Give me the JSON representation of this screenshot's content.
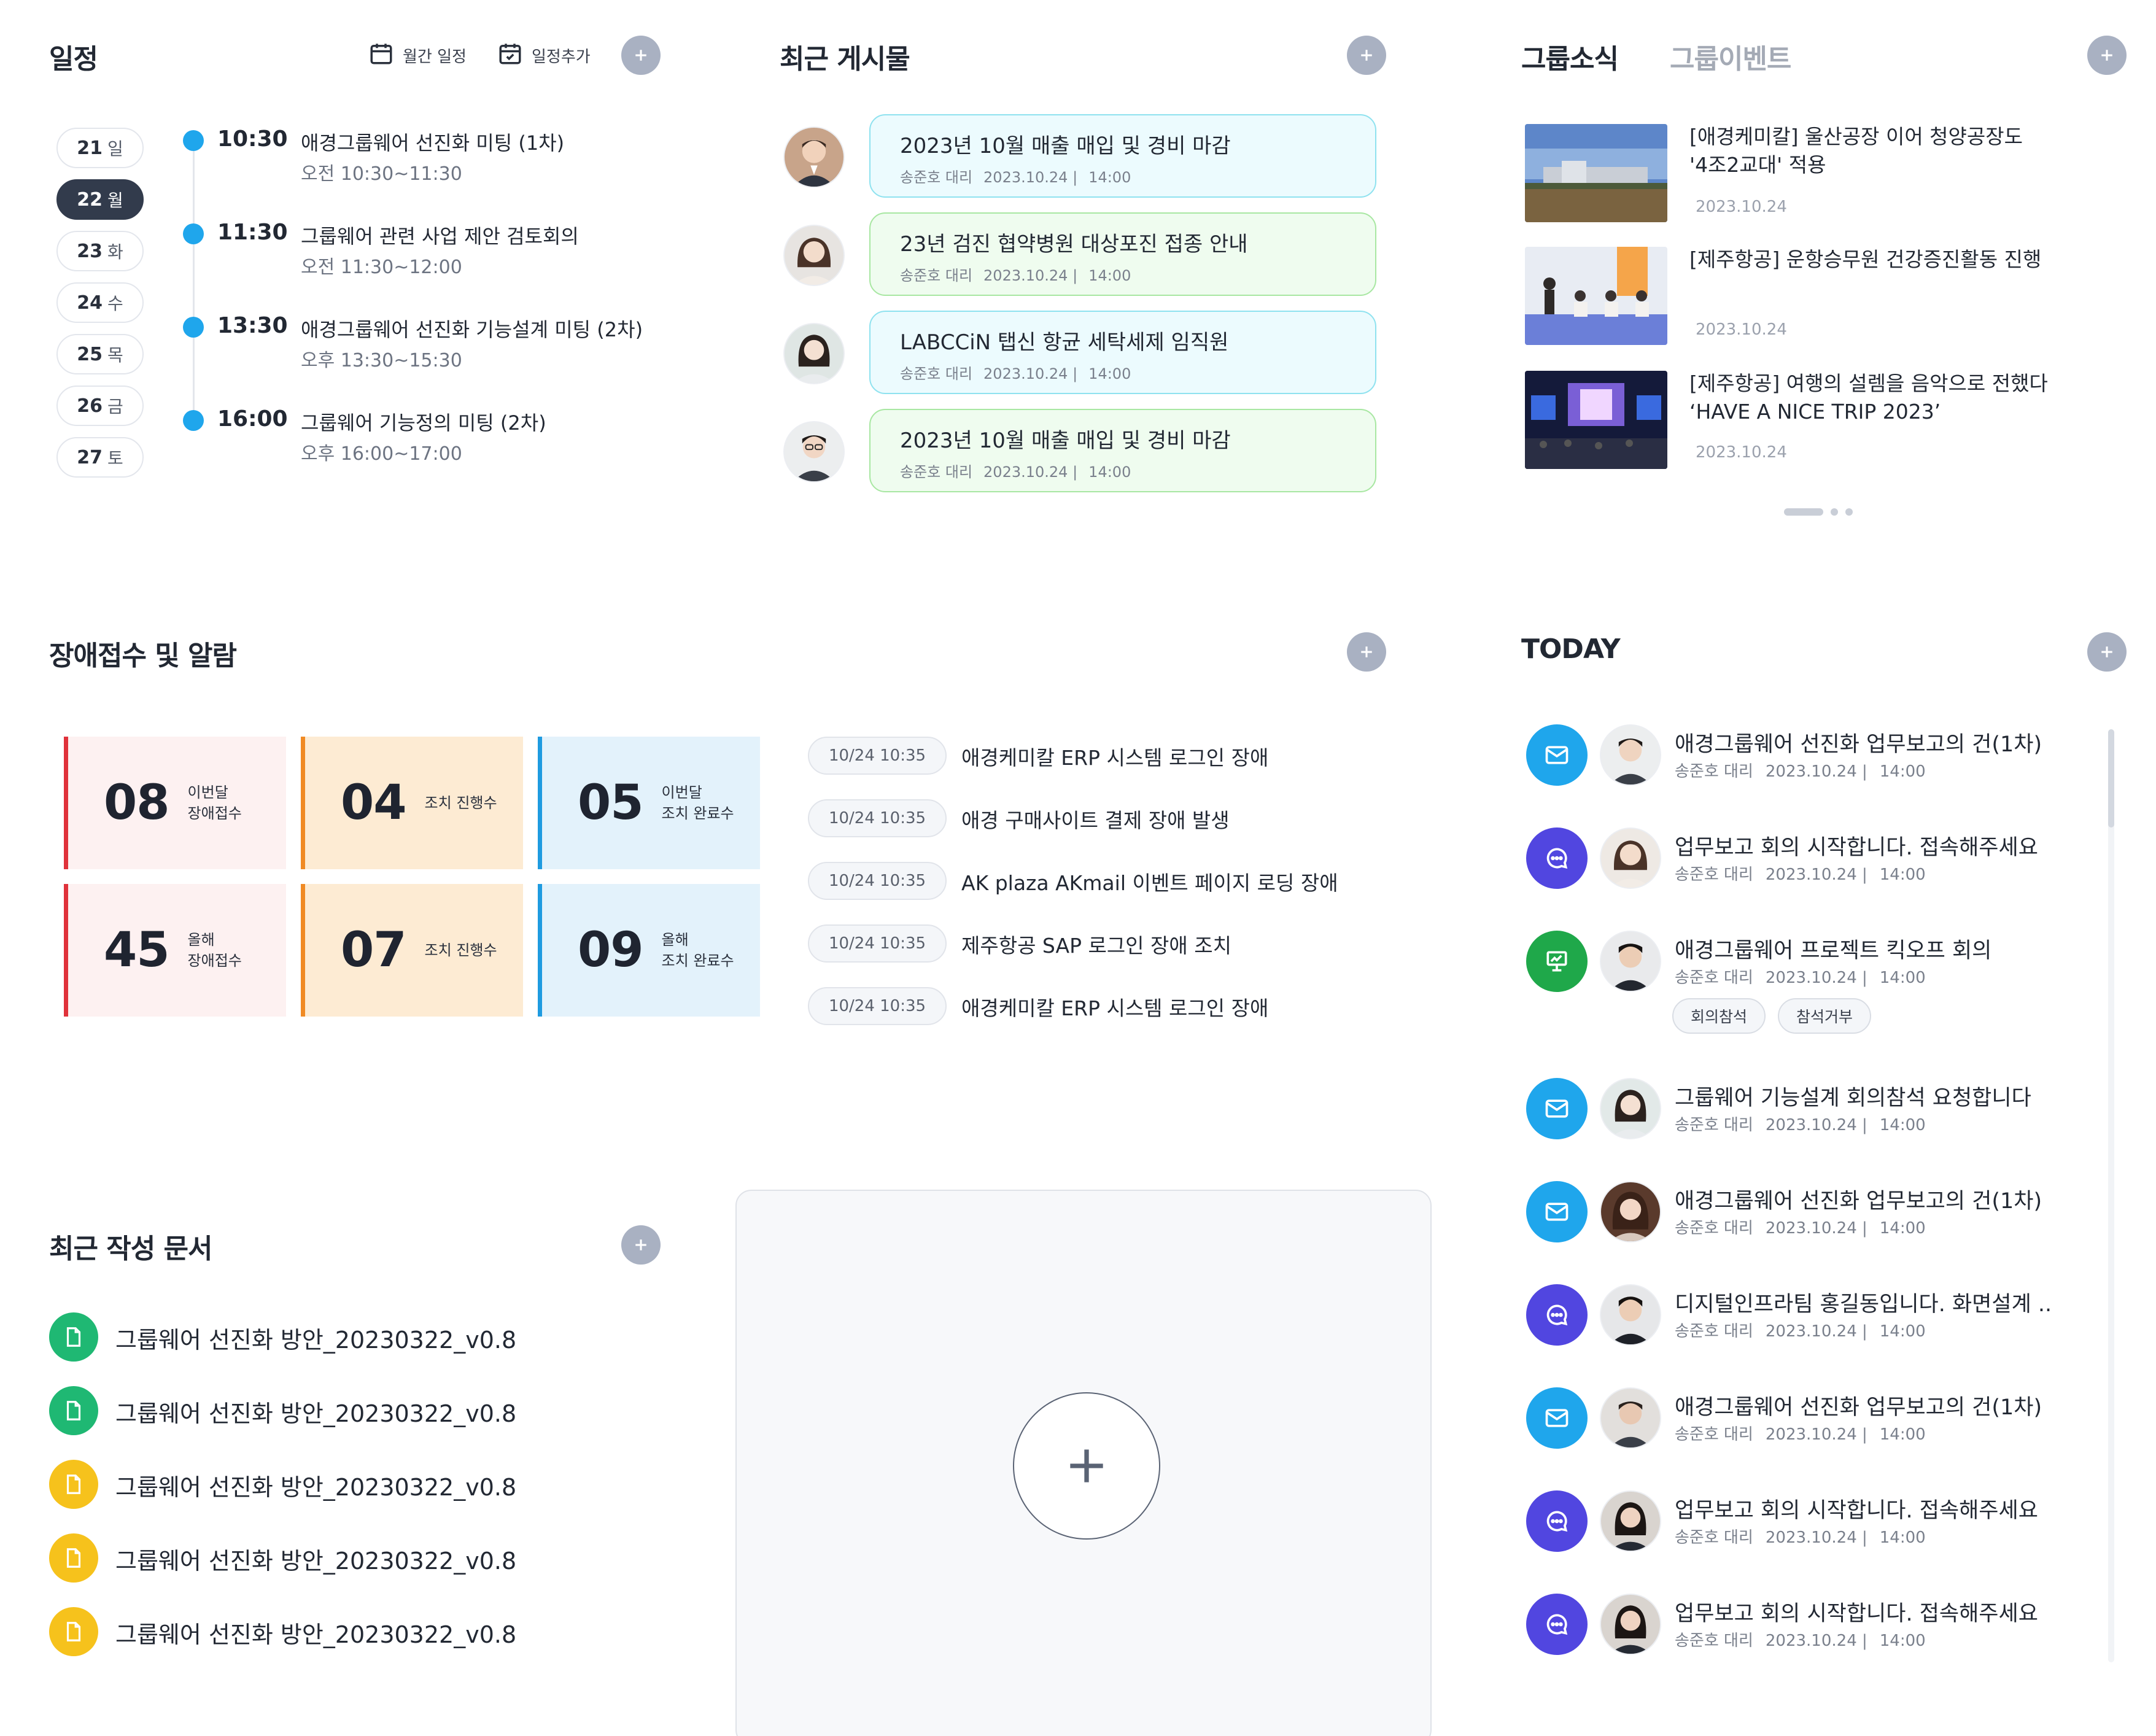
{
  "schedule": {
    "title": "일정",
    "monthly_label": "월간 일정",
    "add_label": "일정추가",
    "days": [
      {
        "num": "21",
        "wd": "일"
      },
      {
        "num": "22",
        "wd": "월"
      },
      {
        "num": "23",
        "wd": "화"
      },
      {
        "num": "24",
        "wd": "수"
      },
      {
        "num": "25",
        "wd": "목"
      },
      {
        "num": "26",
        "wd": "금"
      },
      {
        "num": "27",
        "wd": "토"
      }
    ],
    "events": [
      {
        "time": "10:30",
        "title": "애경그룹웨어 선진화 미팅 (1차)",
        "range": "오전 10:30~11:30"
      },
      {
        "time": "11:30",
        "title": "그룹웨어 관련 사업 제안 검토회의",
        "range": "오전 11:30~12:00"
      },
      {
        "time": "13:30",
        "title": "애경그룹웨어 선진화 기능설계 미팅 (2차)",
        "range": "오후 13:30~15:30"
      },
      {
        "time": "16:00",
        "title": "그룹웨어 기능정의 미팅 (2차)",
        "range": "오후 16:00~17:00"
      }
    ]
  },
  "posts": {
    "title": "최근 게시물",
    "items": [
      {
        "title": "2023년 10월 매출 매입 및 경비 마감",
        "author": "송준호 대리",
        "date": "2023.10.24 |",
        "time": "14:00"
      },
      {
        "title": "23년 검진 협약병원 대상포진 접종 안내",
        "author": "송준호 대리",
        "date": "2023.10.24 |",
        "time": "14:00"
      },
      {
        "title": "LABCCiN 탭신 항균 세탁세제 임직원",
        "author": "송준호 대리",
        "date": "2023.10.24 |",
        "time": "14:00"
      },
      {
        "title": "2023년 10월 매출 매입 및 경비 마감",
        "author": "송준호 대리",
        "date": "2023.10.24 |",
        "time": "14:00"
      }
    ]
  },
  "news": {
    "tab_active": "그룹소식",
    "tab_inactive": "그룹이벤트",
    "items": [
      {
        "line1": "[애경케미칼] 울산공장 이어 청양공장도",
        "line2": "'4조2교대' 적용",
        "date": "2023.10.24"
      },
      {
        "line1": "[제주항공] 운항승무원 건강증진활동 진행",
        "line2": "",
        "date": "2023.10.24"
      },
      {
        "line1": "[제주항공] 여행의 설렘을 음악으로 전했다",
        "line2": "‘HAVE A NICE TRIP 2023’",
        "date": "2023.10.24"
      }
    ]
  },
  "alarm": {
    "title": "장애접수 및 알람",
    "stats": [
      {
        "num": "08",
        "l1": "이번달",
        "l2": "장애접수",
        "color": "#e0323b",
        "bg": "#fdf1f1"
      },
      {
        "num": "04",
        "l1": "조치 진행수",
        "l2": "",
        "color": "#f08a24",
        "bg": "#fdebd3"
      },
      {
        "num": "05",
        "l1": "이번달",
        "l2": "조치 완료수",
        "color": "#1f9be0",
        "bg": "#e3f2fb"
      },
      {
        "num": "45",
        "l1": "올해",
        "l2": "장애접수",
        "color": "#e0323b",
        "bg": "#fdf1f1"
      },
      {
        "num": "07",
        "l1": "조치 진행수",
        "l2": "",
        "color": "#f08a24",
        "bg": "#fdebd3"
      },
      {
        "num": "09",
        "l1": "올해",
        "l2": "조치 완료수",
        "color": "#1f9be0",
        "bg": "#e3f2fb"
      }
    ],
    "items": [
      {
        "time": "10/24  10:35",
        "text": "애경케미칼 ERP 시스템 로그인 장애"
      },
      {
        "time": "10/24  10:35",
        "text": "애경 구매사이트 결제 장애 발생"
      },
      {
        "time": "10/24  10:35",
        "text": "AK plaza AKmail 이벤트 페이지 로딩 장애"
      },
      {
        "time": "10/24  10:35",
        "text": "제주항공 SAP 로그인 장애 조치"
      },
      {
        "time": "10/24  10:35",
        "text": "애경케미칼 ERP 시스템 로그인 장애"
      }
    ]
  },
  "docs": {
    "title": "최근 작성 문서",
    "items": [
      {
        "name": "그룹웨어 선진화 방안_20230322_v0.8",
        "color": "#1fb873"
      },
      {
        "name": "그룹웨어 선진화 방안_20230322_v0.8",
        "color": "#1fb873"
      },
      {
        "name": "그룹웨어 선진화 방안_20230322_v0.8",
        "color": "#f6c21c"
      },
      {
        "name": "그룹웨어 선진화 방안_20230322_v0.8",
        "color": "#f6c21c"
      },
      {
        "name": "그룹웨어 선진화 방안_20230322_v0.8",
        "color": "#f6c21c"
      }
    ]
  },
  "today": {
    "title": "TODAY",
    "items": [
      {
        "icon": "mail-icon",
        "title": "애경그룹웨어 선진화 업무보고의 건(1차)",
        "author": "송준호 대리",
        "date": "2023.10.24 |",
        "time": "14:00"
      },
      {
        "icon": "chat-icon",
        "title": "업무보고 회의 시작합니다. 접속해주세요",
        "author": "송준호 대리",
        "date": "2023.10.24 |",
        "time": "14:00"
      },
      {
        "icon": "presentation-icon",
        "title": "애경그룹웨어 프로젝트 킥오프 회의",
        "author": "송준호 대리",
        "date": "2023.10.24 |",
        "time": "14:00"
      },
      {
        "icon": "mail-icon",
        "title": "그룹웨어 기능설계 회의참석 요청합니다",
        "author": "송준호 대리",
        "date": "2023.10.24 |",
        "time": "14:00"
      },
      {
        "icon": "mail-icon",
        "title": "애경그룹웨어 선진화 업무보고의 건(1차)",
        "author": "송준호 대리",
        "date": "2023.10.24 |",
        "time": "14:00"
      },
      {
        "icon": "chat-icon",
        "title": "디지털인프라팀 홍길동입니다. 화면설계 ..",
        "author": "송준호 대리",
        "date": "2023.10.24 |",
        "time": "14:00"
      },
      {
        "icon": "mail-icon",
        "title": "애경그룹웨어 선진화 업무보고의 건(1차)",
        "author": "송준호 대리",
        "date": "2023.10.24 |",
        "time": "14:00"
      },
      {
        "icon": "chat-icon",
        "title": "업무보고 회의 시작합니다. 접속해주세요",
        "author": "송준호 대리",
        "date": "2023.10.24 |",
        "time": "14:00"
      },
      {
        "icon": "chat-icon",
        "title": "업무보고 회의 시작합니다. 접속해주세요",
        "author": "송준호 대리",
        "date": "2023.10.24 |",
        "time": "14:00"
      }
    ],
    "attend_label": "회의참석",
    "decline_label": "참석거부"
  },
  "colors": {
    "mail": "#1fa6ec",
    "chat": "#5146e0",
    "presentation": "#1fa84a"
  }
}
